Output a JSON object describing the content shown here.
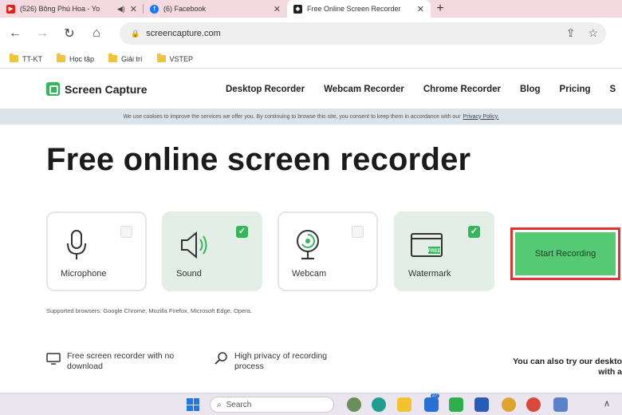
{
  "browser": {
    "tabs": [
      {
        "title": "(526) Bông Phú Hoa - Yo",
        "favicon": "youtube-icon",
        "color": "#e62117"
      },
      {
        "title": "(6) Facebook",
        "favicon": "facebook-icon",
        "color": "#1877f2"
      },
      {
        "title": "Free Online Screen Recorder",
        "favicon": "screencapture-icon",
        "color": "#222222"
      }
    ],
    "url": "screencapture.com",
    "bookmarks": [
      "TT-KT",
      "Học tập",
      "Giải trí",
      "VSTEP"
    ]
  },
  "site": {
    "logo_text": "Screen Capture",
    "nav": [
      "Desktop Recorder",
      "Webcam Recorder",
      "Chrome Recorder",
      "Blog",
      "Pricing",
      "S"
    ],
    "cookie_text": "We use cookies to improve the services we offer you. By continuing to browse this site, you consent to keep them in accordance with our",
    "cookie_link": "Privacy Policy.",
    "headline": "Free online screen recorder",
    "options": [
      {
        "label": "Microphone",
        "checked": false
      },
      {
        "label": "Sound",
        "checked": true
      },
      {
        "label": "Webcam",
        "checked": false
      },
      {
        "label": "Watermark",
        "checked": true
      }
    ],
    "start_label": "Start Recording",
    "supported": "Supported browsers: Google Chrome, Mozilla Firefox, Microsoft Edge, Opera.",
    "features": [
      {
        "text_line1": "Free screen recorder with no",
        "text_line2": "download"
      },
      {
        "text_line1": "High privacy of recording",
        "text_line2": "process"
      }
    ],
    "also_line1": "You can also try our deskto",
    "also_line2": "with a",
    "watermark_badge": "FREE"
  },
  "taskbar": {
    "search_label": "Search",
    "badge_count": "27"
  },
  "colors": {
    "accent_green": "#35b65a",
    "button_green": "#55c973",
    "highlight_red": "#e03232"
  }
}
